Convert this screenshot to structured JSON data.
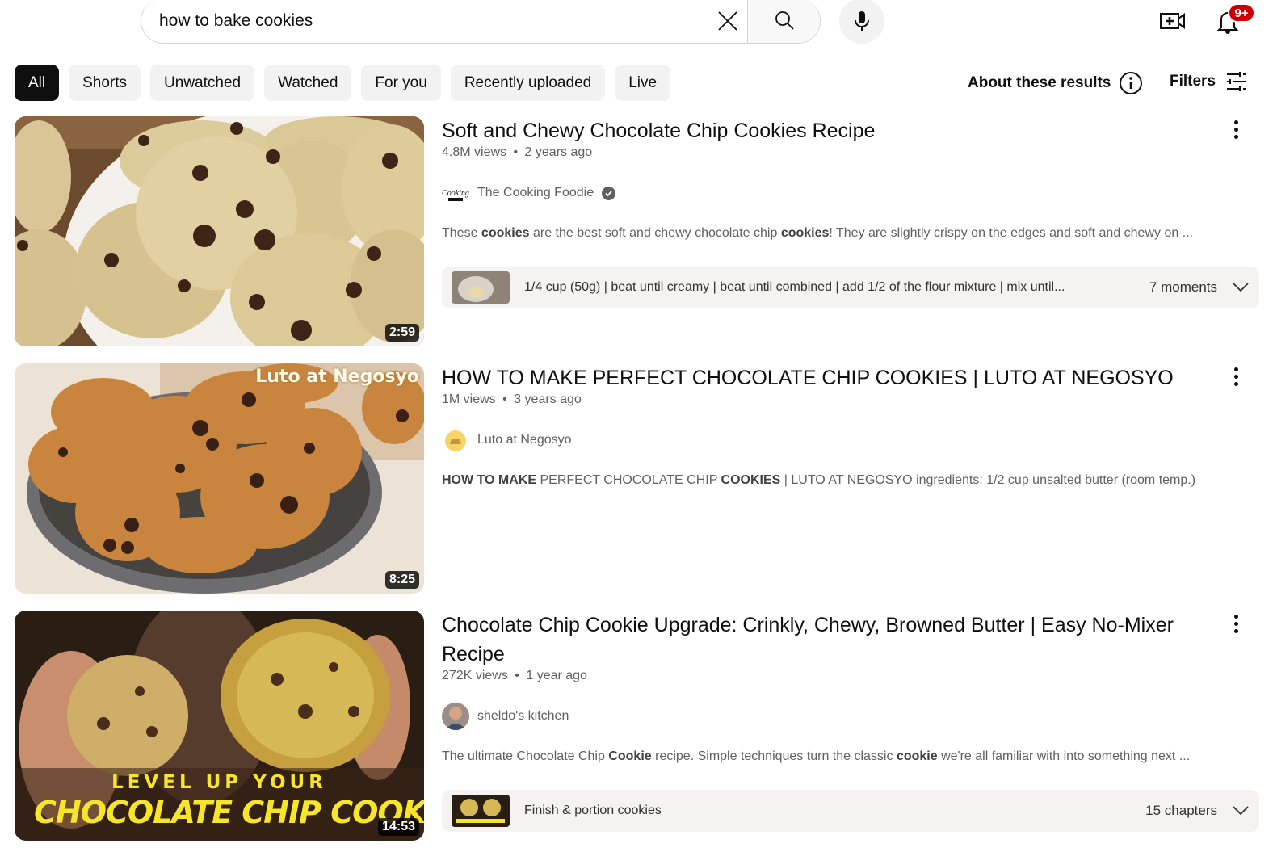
{
  "header": {
    "search": {
      "value": "how to bake cookies",
      "placeholder": "Search"
    },
    "icons": {
      "clear": "close-icon",
      "search": "search-icon",
      "mic": "microphone-icon",
      "create": "create-video-icon",
      "notifications": "bell-icon"
    },
    "notification_badge": "9+",
    "badge_color": "#cc0000"
  },
  "chips": [
    {
      "label": "All",
      "active": true
    },
    {
      "label": "Shorts"
    },
    {
      "label": "Unwatched"
    },
    {
      "label": "Watched"
    },
    {
      "label": "For you"
    },
    {
      "label": "Recently uploaded"
    },
    {
      "label": "Live"
    }
  ],
  "toolbar": {
    "about_label": "About these results",
    "filters_label": "Filters"
  },
  "results": [
    {
      "title": "Soft and Chewy Chocolate Chip Cookies Recipe",
      "views": "4.8M views",
      "age": "2 years ago",
      "channel": "The Cooking Foodie",
      "verified": true,
      "description_parts": [
        {
          "text": "These "
        },
        {
          "text": "cookies",
          "bold": true
        },
        {
          "text": " are the best soft and chewy chocolate chip "
        },
        {
          "text": "cookies",
          "bold": true
        },
        {
          "text": "! They are slightly crispy on the edges and soft and chewy on ..."
        }
      ],
      "duration": "2:59",
      "moments": {
        "text": "1/4 cup (50g) | beat until creamy | beat until combined | add 1/2 of the flour mixture | mix until...",
        "count": "7 moments"
      }
    },
    {
      "title": "HOW TO MAKE PERFECT CHOCOLATE CHIP COOKIES | LUTO AT NEGOSYO",
      "views": "1M views",
      "age": "3 years ago",
      "channel": "Luto at Negosyo",
      "verified": false,
      "description_parts": [
        {
          "text": "HOW TO MAKE",
          "bold": true
        },
        {
          "text": " PERFECT CHOCOLATE CHIP "
        },
        {
          "text": "COOKIES",
          "bold": true
        },
        {
          "text": " | LUTO AT NEGOSYO ingredients: 1/2 cup unsalted butter (room temp.)"
        }
      ],
      "duration": "8:25",
      "thumbnail_overlay": "Luto at Negosyo"
    },
    {
      "title": "Chocolate Chip Cookie Upgrade: Crinkly, Chewy, Browned Butter | Easy No-Mixer Recipe",
      "views": "272K views",
      "age": "1 year ago",
      "channel": "sheldo's kitchen",
      "verified": false,
      "description_parts": [
        {
          "text": "The ultimate Chocolate Chip "
        },
        {
          "text": "Cookie",
          "bold": true
        },
        {
          "text": " recipe. Simple techniques turn the classic "
        },
        {
          "text": "cookie",
          "bold": true
        },
        {
          "text": " we're all familiar with into something next ..."
        }
      ],
      "duration": "14:53",
      "thumbnail_overlay_top": "LEVEL UP YOUR",
      "thumbnail_overlay_bottom": "CHOCOLATE CHIP COOKIE",
      "moments": {
        "text": "Finish & portion cookies",
        "count": "15 chapters"
      }
    }
  ],
  "meta_separator": "•"
}
